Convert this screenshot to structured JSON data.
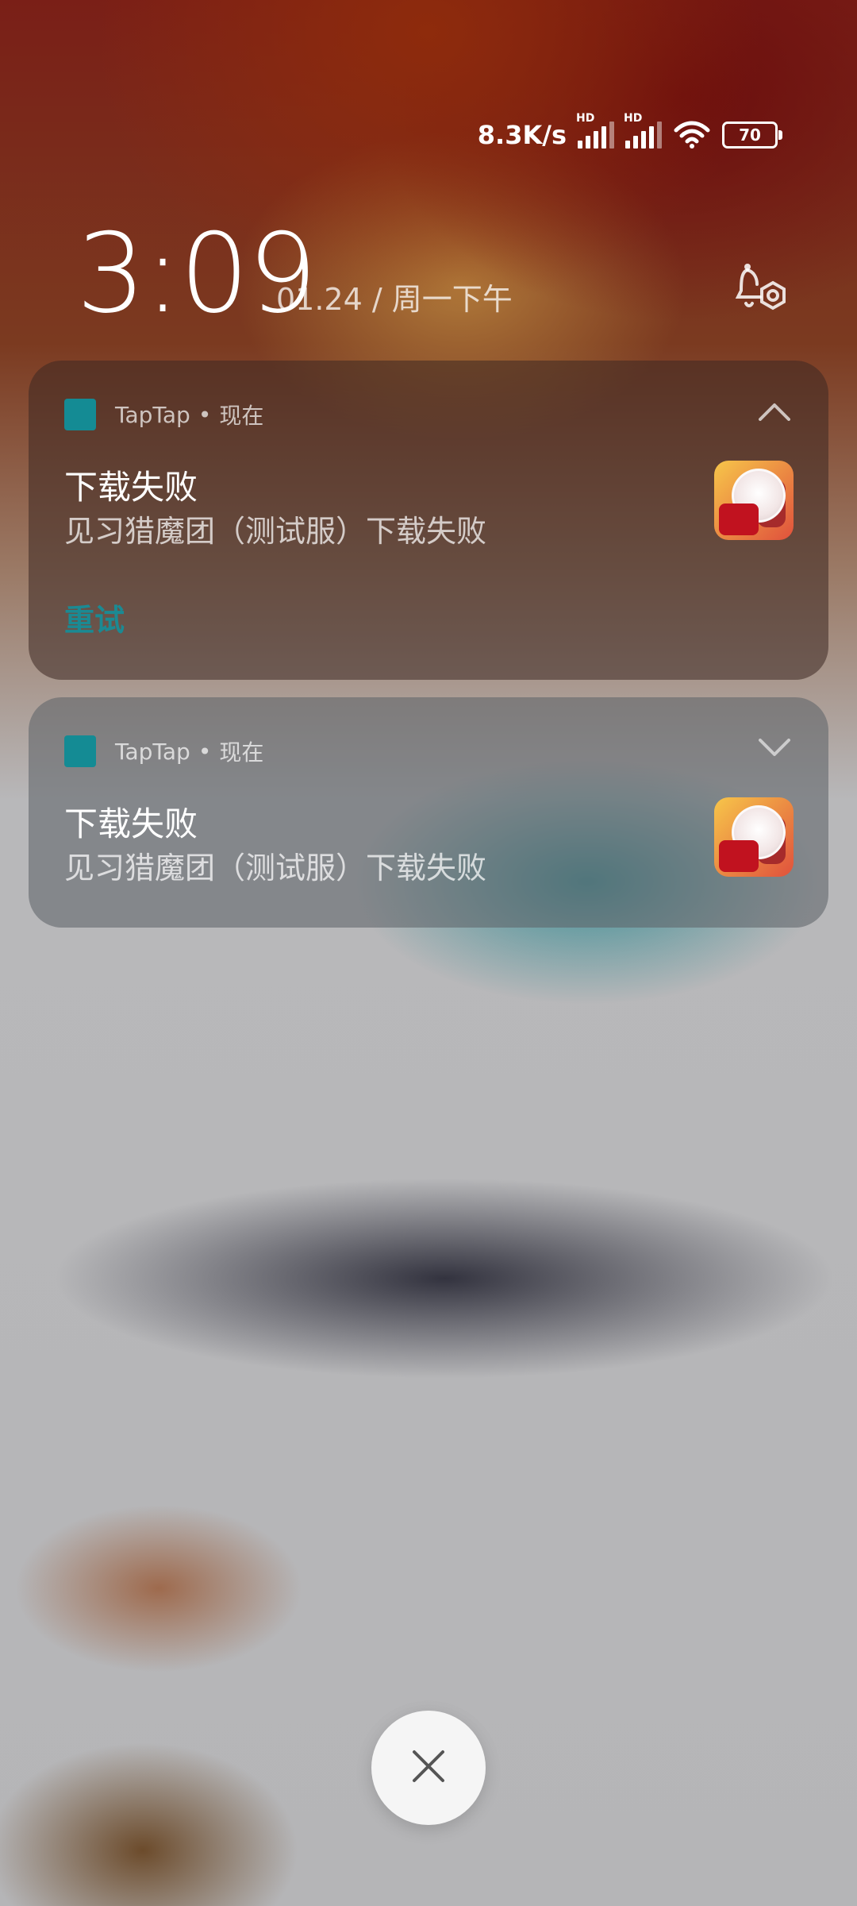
{
  "status": {
    "speed": "8.3K/s",
    "hd1": "HD",
    "hd2": "HD",
    "battery": "70"
  },
  "clock": {
    "time": "3:09",
    "date": "01.24 / 周一下午"
  },
  "notifications": [
    {
      "app_name": "TapTap",
      "when": "现在",
      "title": "下载失败",
      "text": "见习猎魔团（测试服）下载失败",
      "action": "重试",
      "expanded": true
    },
    {
      "app_name": "TapTap",
      "when": "现在",
      "title": "下载失败",
      "text": "见习猎魔团（测试服）下载失败",
      "expanded": false
    }
  ],
  "icons": {
    "bell_settings": "bell-settings-icon",
    "close": "close-icon",
    "wifi": "wifi-icon",
    "signal": "signal-icon",
    "battery": "battery-icon"
  },
  "colors": {
    "accent": "#148b94",
    "retry": "#1b8a93"
  }
}
